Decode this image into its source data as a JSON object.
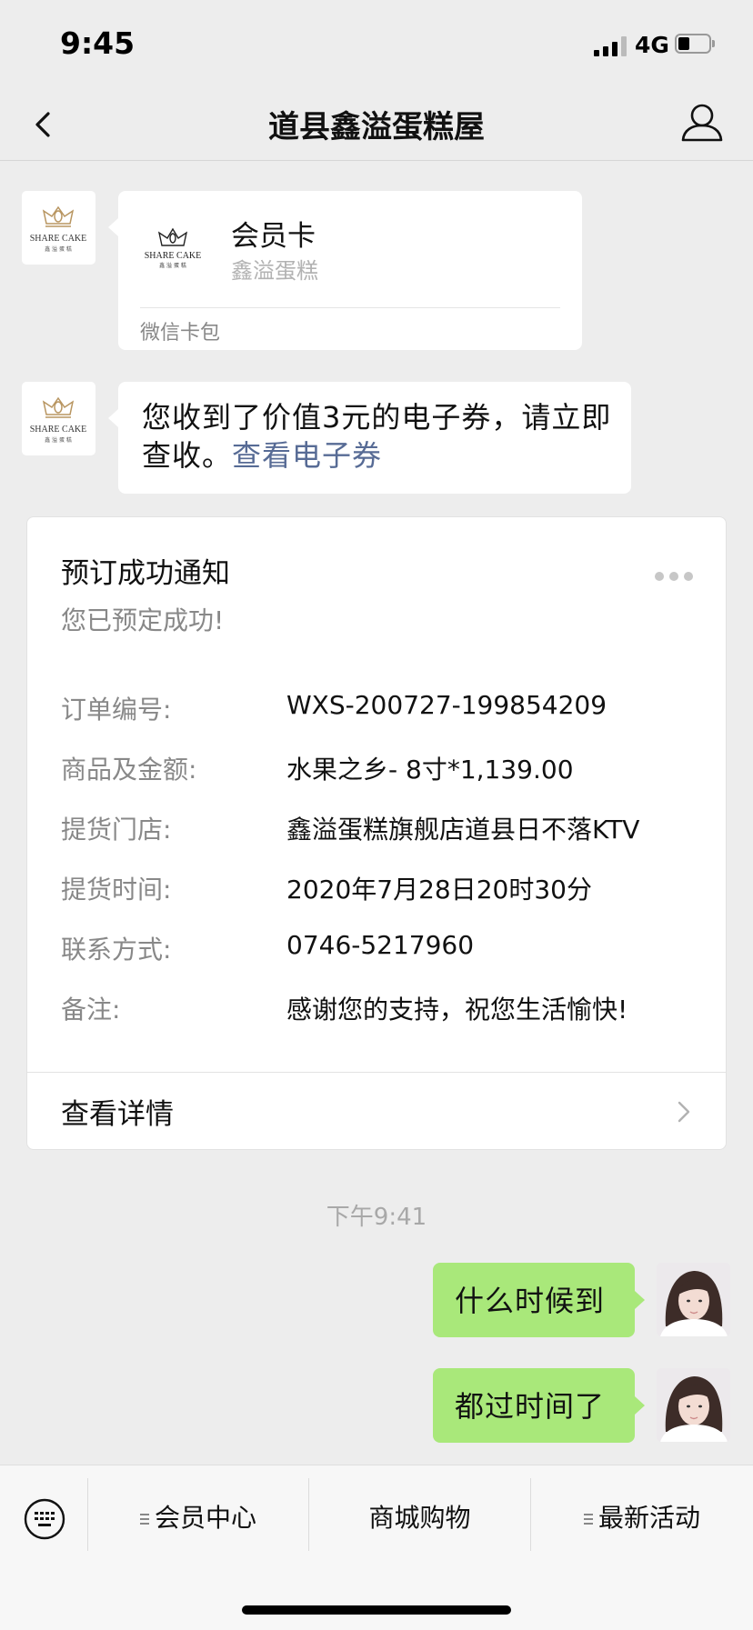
{
  "status_bar": {
    "time": "9:45",
    "network": "4G",
    "battery_level": 0.3
  },
  "nav": {
    "title": "道县鑫溢蛋糕屋"
  },
  "messages": {
    "member_card": {
      "logo_text": "SHARE CAKE",
      "title": "会员卡",
      "subtitle": "鑫溢蛋糕",
      "footer": "微信卡包"
    },
    "coupon": {
      "text": "您收到了价值3元的电子券，请立即查收。",
      "link": "查看电子券"
    }
  },
  "notice": {
    "title": "预订成功通知",
    "subtitle": "您已预定成功!",
    "fields": [
      {
        "label": "订单编号:",
        "value": "WXS-200727-199854209"
      },
      {
        "label": "商品及金额:",
        "value": "水果之乡- 8寸*1,139.00"
      },
      {
        "label": "提货门店:",
        "value": "鑫溢蛋糕旗舰店道县日不落KTV"
      },
      {
        "label": "提货时间:",
        "value": "2020年7月28日20时30分"
      },
      {
        "label": "联系方式:",
        "value": "0746-5217960"
      },
      {
        "label": "备注:",
        "value": "感谢您的支持，祝您生活愉快!"
      }
    ],
    "detail_link": "查看详情"
  },
  "timestamp": "下午9:41",
  "user_messages": [
    "什么时候到",
    "都过时间了"
  ],
  "bottom_menu": {
    "items": [
      "会员中心",
      "商城购物",
      "最新活动"
    ]
  }
}
